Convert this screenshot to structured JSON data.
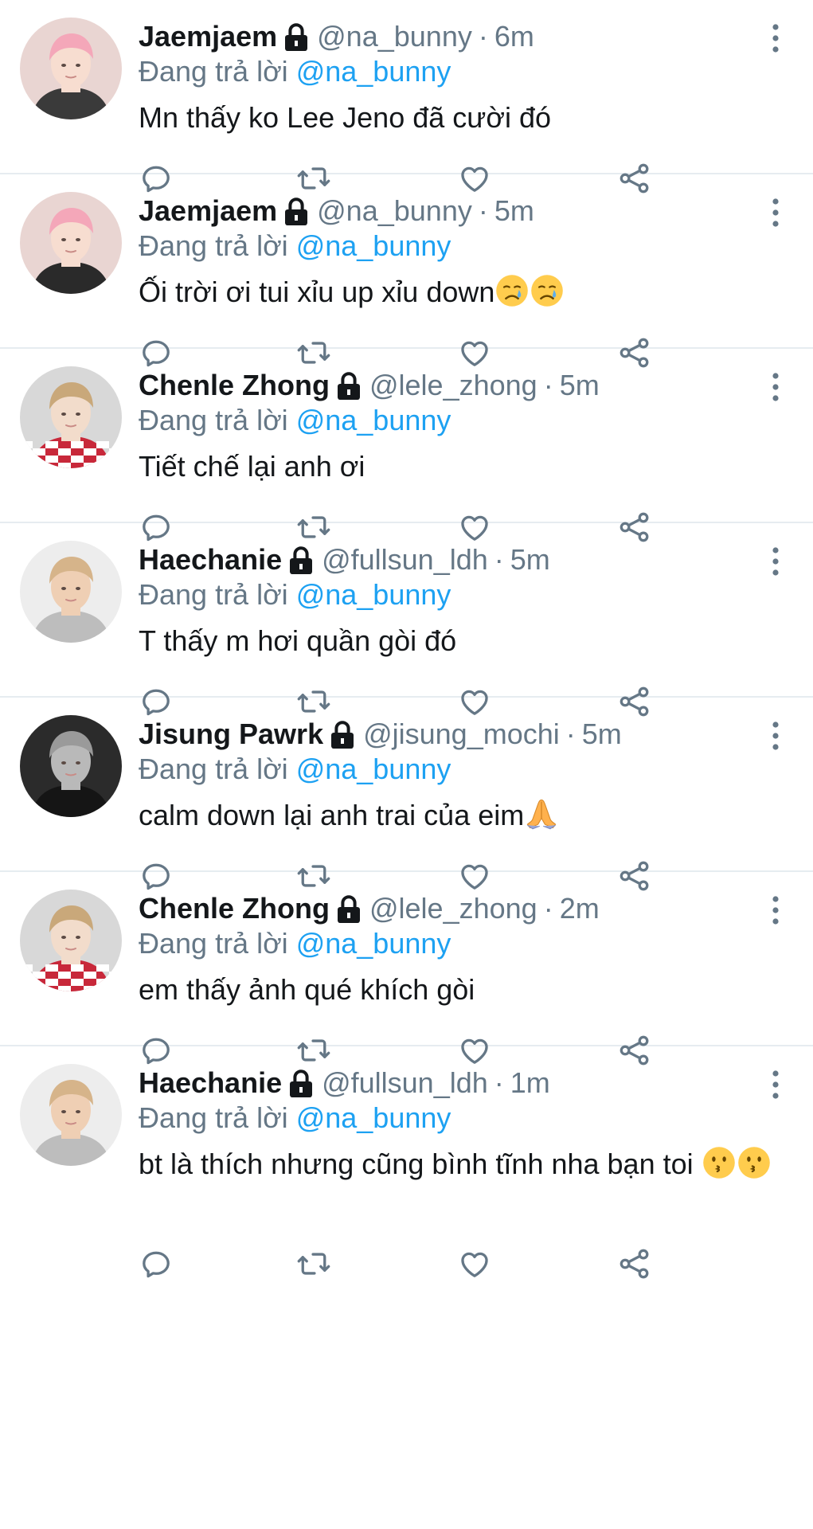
{
  "reply_prefix": "Đang trả lời",
  "tweets": [
    {
      "name": "Jaemjaem",
      "handle": "@na_bunny",
      "time": "6m",
      "reply_to": "@na_bunny",
      "text": "Mn thấy ko Lee Jeno đã cười đó",
      "avatar": {
        "bg": "#e9d5d2",
        "hair": "#f4a7b9",
        "skin": "#f7ddd0",
        "shirt": "#3a3a3a"
      }
    },
    {
      "name": "Jaemjaem",
      "handle": "@na_bunny",
      "time": "5m",
      "reply_to": "@na_bunny",
      "text": "Ối trời ơi tui xỉu up xỉu down",
      "emoji": [
        "crying-face",
        "crying-face"
      ],
      "avatar": {
        "bg": "#e9d5d2",
        "hair": "#f4a7b9",
        "skin": "#f7ddd0",
        "shirt": "#2a2a2a"
      }
    },
    {
      "name": "Chenle Zhong",
      "handle": "@lele_zhong",
      "time": "5m",
      "reply_to": "@na_bunny",
      "text": "Tiết chế lại anh ơi",
      "avatar": {
        "bg": "#d8d8d8",
        "hair": "#c9a87a",
        "skin": "#f2dccb",
        "shirt": "#c8283a",
        "pattern": "checker"
      }
    },
    {
      "name": "Haechanie",
      "handle": "@fullsun_ldh",
      "time": "5m",
      "reply_to": "@na_bunny",
      "text": "T thấy m hơi quần gòi đó",
      "avatar": {
        "bg": "#ededed",
        "hair": "#d6b48a",
        "skin": "#efcfb4",
        "shirt": "#bdbdbd"
      }
    },
    {
      "name": "Jisung Pawrk",
      "handle": "@jisung_mochi",
      "time": "5m",
      "reply_to": "@na_bunny",
      "text": "calm down lại anh trai của eim",
      "emoji": [
        "folded-hands"
      ],
      "avatar": {
        "bg": "#2b2b2b",
        "hair": "#9a9a9a",
        "skin": "#b9b9b9",
        "shirt": "#151515"
      }
    },
    {
      "name": "Chenle Zhong",
      "handle": "@lele_zhong",
      "time": "2m",
      "reply_to": "@na_bunny",
      "text": "em thấy ảnh qué khích gòi",
      "avatar": {
        "bg": "#d8d8d8",
        "hair": "#c9a87a",
        "skin": "#f2dccb",
        "shirt": "#c8283a",
        "pattern": "checker"
      }
    },
    {
      "name": "Haechanie",
      "handle": "@fullsun_ldh",
      "time": "1m",
      "reply_to": "@na_bunny",
      "text": "bt là thích nhưng cũng bình tĩnh nha bạn toi ",
      "emoji": [
        "kissing-face",
        "kissing-face"
      ],
      "avatar": {
        "bg": "#ededed",
        "hair": "#d6b48a",
        "skin": "#efcfb4",
        "shirt": "#bdbdbd"
      }
    }
  ],
  "colors": {
    "name": "#14171a",
    "muted": "#657786",
    "link": "#1da1f2",
    "icon": "#657786",
    "divider": "#e6ecf0"
  }
}
